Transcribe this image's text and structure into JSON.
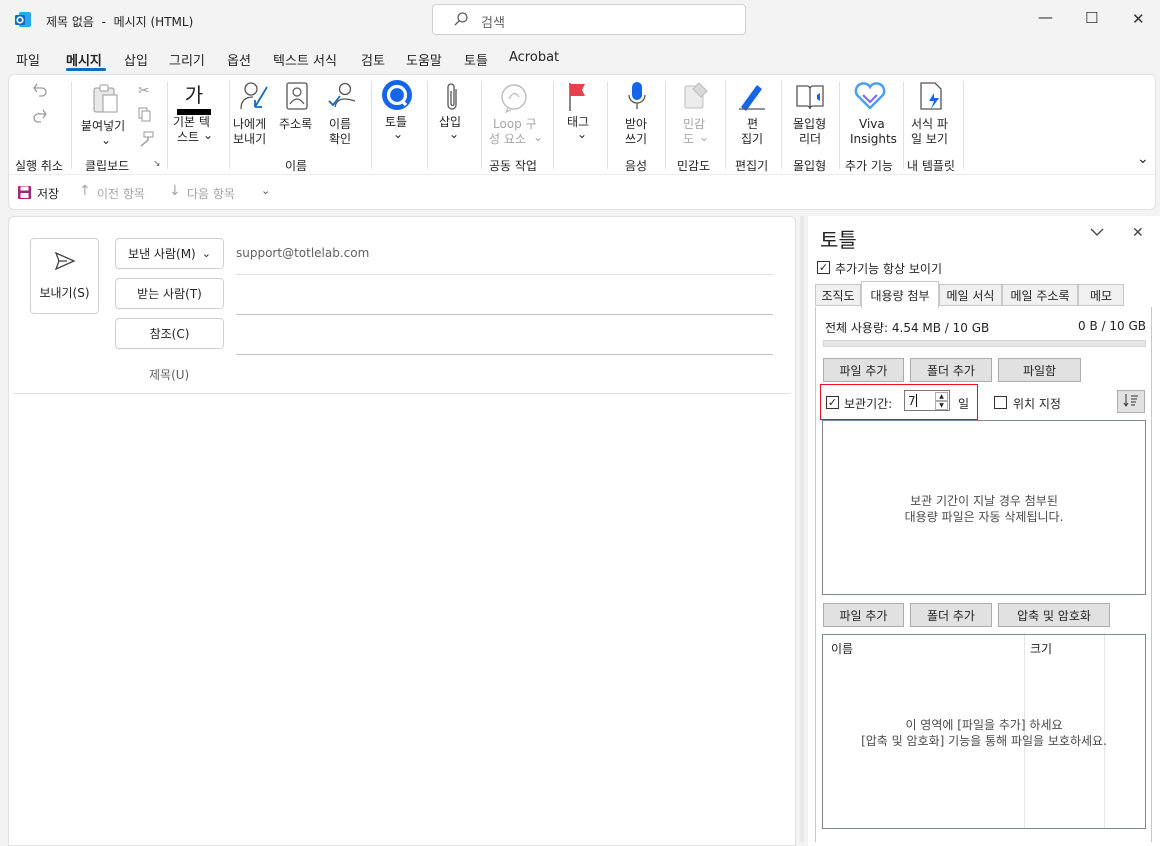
{
  "window": {
    "title": "제목 없음  -  메시지 (HTML)",
    "search_placeholder": "검색",
    "minimize": "—",
    "maximize": "☐",
    "close": "✕"
  },
  "menu": [
    "파일",
    "메시지",
    "삽입",
    "그리기",
    "옵션",
    "텍스트 서식",
    "검토",
    "도움말",
    "토틀",
    "Acrobat"
  ],
  "ribbon": {
    "undo_group": "실행 취소",
    "paste": "붙여넣기",
    "clipboard_group": "클립보드",
    "basic_text_1": "기본 텍",
    "basic_text_2": "스트",
    "send_to_me_1": "나에게",
    "send_to_me_2": "보내기",
    "address_book": "주소록",
    "check_names_1": "이름",
    "check_names_2": "확인",
    "names_group": "이름",
    "totle": "토틀",
    "insert": "삽입",
    "loop_1": "Loop 구",
    "loop_2": "성 요소",
    "collab_group": "공동 작업",
    "tags": "태그",
    "dictate_1": "받아",
    "dictate_2": "쓰기",
    "voice_group": "음성",
    "sensitivity_1": "민감",
    "sensitivity_2": "도",
    "sensitivity_group": "민감도",
    "editor_1": "편",
    "editor_2": "집기",
    "editor_group": "편집기",
    "immersive_1": "몰입형",
    "immersive_2": "리더",
    "immersive_group": "몰입형",
    "viva_1": "Viva",
    "viva_2": "Insights",
    "addins_group": "추가 기능",
    "templates_1": "서식 파",
    "templates_2": "일 보기",
    "templates_group": "내 템플릿"
  },
  "qat": {
    "save": "저장",
    "prev": "이전 항목",
    "next": "다음 항목"
  },
  "compose": {
    "send": "보내기(S)",
    "from": "보낸 사람(M)",
    "from_value": "support@totlelab.com",
    "to": "받는 사람(T)",
    "cc": "참조(C)",
    "subject": "제목(U)"
  },
  "pane": {
    "title": "토틀",
    "always_show": "추가기능 항상 보이기",
    "tabs": [
      "조직도",
      "대용량 첨부",
      "메일 서식",
      "메일 주소록",
      "메모"
    ],
    "usage_label": "전체 사용량: 4.54 MB / 10 GB",
    "usage_right": "0 B / 10 GB",
    "add_file": "파일 추가",
    "add_folder": "폴더 추가",
    "file_box": "파일함",
    "retention_label": "보관기간:",
    "retention_value": "7",
    "retention_unit": "일",
    "location_label": "위치 지정",
    "info_line1": "보관 기간이 지날 경우 첨부된",
    "info_line2": "대용량 파일은 자동 삭제됩니다.",
    "add_file2": "파일 추가",
    "add_folder2": "폴더 추가",
    "zip_encrypt": "압축 및 암호화",
    "col_name": "이름",
    "col_size": "크기",
    "list_hint1": "이 영역에 [파일을 추가] 하세요",
    "list_hint2": "[압축 및 암호화] 기능을 통해 파일을 보호하세요."
  },
  "colors": {
    "accent": "#0f6cbd",
    "highlight_box": "#e81123"
  }
}
